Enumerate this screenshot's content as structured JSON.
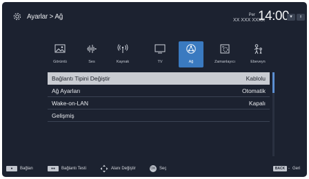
{
  "header": {
    "breadcrumb": "Ayarlar > Ağ",
    "day": "Per",
    "date": "XX XXX XXXX",
    "time": "14:00",
    "indicator_1": "▾",
    "indicator_2": "ᵻ"
  },
  "categories": [
    {
      "label": "Görüntü",
      "icon": "picture-icon"
    },
    {
      "label": "Ses",
      "icon": "sound-icon"
    },
    {
      "label": "Kaynak",
      "icon": "source-icon"
    },
    {
      "label": "TV",
      "icon": "tv-icon"
    },
    {
      "label": "Ağ",
      "icon": "network-icon",
      "selected": true
    },
    {
      "label": "Zamanlayıcı",
      "icon": "timer-icon"
    },
    {
      "label": "Ebeveyn",
      "icon": "parental-icon"
    }
  ],
  "menu": [
    {
      "label": "Bağlantı Tipini Değiştir",
      "value": "Kablolu",
      "selected": true
    },
    {
      "label": "Ağ Ayarları",
      "value": "Otomatik"
    },
    {
      "label": "Wake-on-LAN",
      "value": "Kapalı"
    },
    {
      "label": "Gelişmiş",
      "value": ""
    }
  ],
  "footer": {
    "btn1_key": "●",
    "btn1_label": "Bağlan",
    "btn2_key": "●●",
    "btn2_label": "Bağlantı Testi",
    "btn3_label": "Alanı Değiştir",
    "btn4_key": "OK",
    "btn4_label": "Seç",
    "back_key": "BACK",
    "back_label": "Geri"
  },
  "colors": {
    "background": "#1c2230",
    "selected_tab": "#3a7ac0",
    "selected_row": "#c9ccd2",
    "scroll_thumb": "#5c8fd1"
  }
}
